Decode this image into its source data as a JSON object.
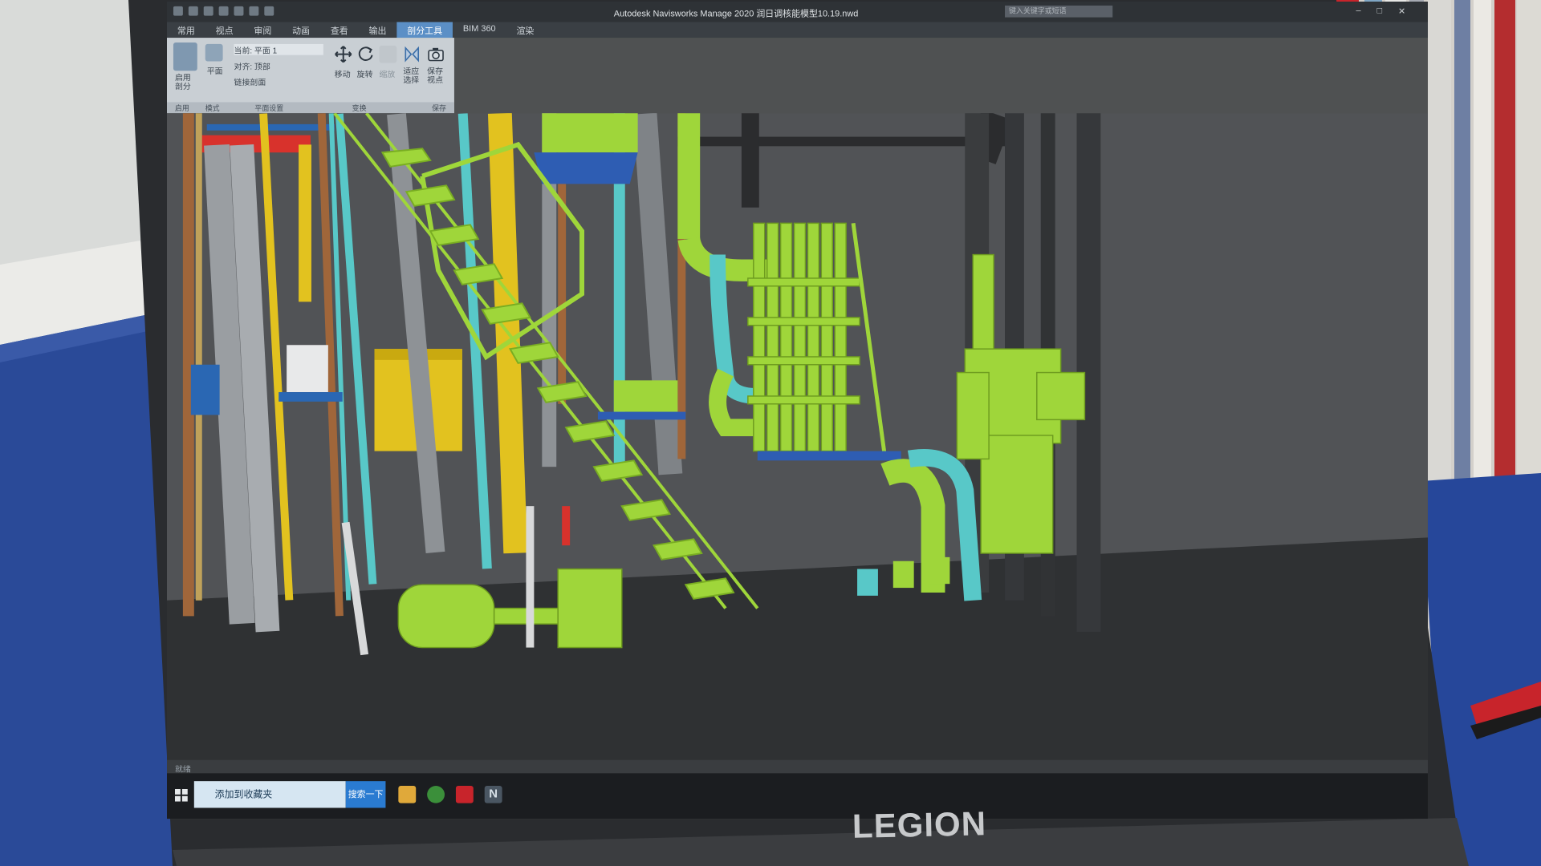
{
  "app": {
    "title": "Autodesk Navisworks Manage 2020    润日调核能模型10.19.nwd",
    "help_search_placeholder": "键入关键字或短语"
  },
  "tabs": [
    {
      "label": "常用"
    },
    {
      "label": "视点"
    },
    {
      "label": "审阅"
    },
    {
      "label": "动画"
    },
    {
      "label": "查看"
    },
    {
      "label": "输出"
    },
    {
      "label": "剖分工具",
      "active": true
    },
    {
      "label": "BIM 360"
    },
    {
      "label": "渲染"
    }
  ],
  "ribbon": {
    "enable_label": "启用\n剖分",
    "plane_label": "平面",
    "current_plane": "当前: 平面 1",
    "alignment": "对齐: 顶部",
    "link_label": "链接剖面",
    "move_label": "移动",
    "rotate_label": "旋转",
    "scale_label": "缩放",
    "fit_label": "适应\n选择",
    "save_view_label": "保存\n视点",
    "groups": {
      "enable": "启用",
      "mode": "模式",
      "plane_settings": "平面设置",
      "transform": "变换",
      "save": "保存"
    }
  },
  "statusbar": {
    "text": "就绪"
  },
  "taskbar": {
    "task_label": "添加到收藏夹",
    "task_button": "搜索一下",
    "pinned_app": "N"
  },
  "laptop": {
    "brand": "LEGION"
  },
  "colors": {
    "pipe_green": "#9fd63a",
    "pipe_cyan": "#58c8c8",
    "pipe_gray": "#9a9ea2",
    "equip_yellow": "#e2c21f",
    "equip_blue": "#2e5db3",
    "frame_red": "#d8322c",
    "pipe_brown": "#a0663a"
  }
}
